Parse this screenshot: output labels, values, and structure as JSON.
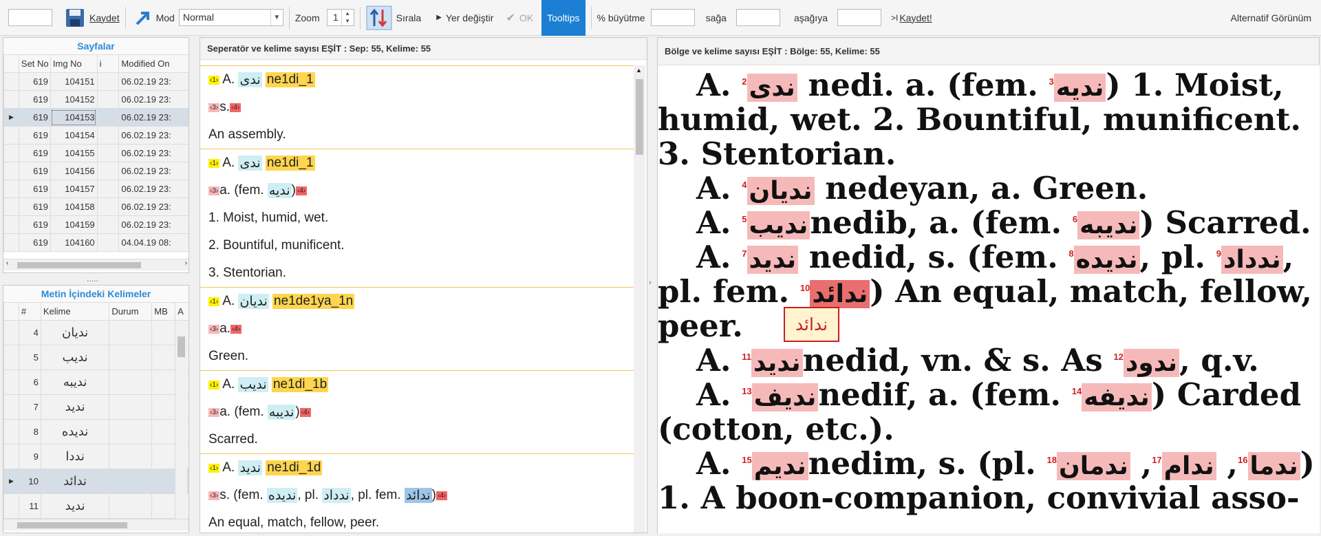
{
  "toolbar": {
    "page_value": "",
    "save_label": "Kaydet",
    "mode_label": "Mod",
    "mode_value": "Normal",
    "zoom_label": "Zoom",
    "zoom_value": "1",
    "sort_label": "Sırala",
    "swap_label": "Yer değiştir",
    "ok_label": "OK",
    "tooltips_label": "Tooltips",
    "enlarge_label": "% büyütme",
    "right_label": "sağa",
    "down_label": "aşağıya",
    "save2_label": "Kaydet!",
    "alt_view_label": "Alternatif Görünüm"
  },
  "pages": {
    "title": "Sayfalar",
    "columns": [
      "Set No",
      "Img No",
      "i",
      "Modified On"
    ],
    "rows": [
      {
        "set": "619",
        "img": "104151",
        "mod": "06.02.19 23:"
      },
      {
        "set": "619",
        "img": "104152",
        "mod": "06.02.19 23:"
      },
      {
        "set": "619",
        "img": "104153",
        "mod": "06.02.19 23:",
        "selected": true
      },
      {
        "set": "619",
        "img": "104154",
        "mod": "06.02.19 23:"
      },
      {
        "set": "619",
        "img": "104155",
        "mod": "06.02.19 23:"
      },
      {
        "set": "619",
        "img": "104156",
        "mod": "06.02.19 23:"
      },
      {
        "set": "619",
        "img": "104157",
        "mod": "06.02.19 23:"
      },
      {
        "set": "619",
        "img": "104158",
        "mod": "06.02.19 23:"
      },
      {
        "set": "619",
        "img": "104159",
        "mod": "06.02.19 23:"
      },
      {
        "set": "619",
        "img": "104160",
        "mod": "04.04.19 08:"
      }
    ]
  },
  "splitter_dots": ".....",
  "words": {
    "title": "Metin İçindeki Kelimeler",
    "columns": [
      "#",
      "Kelime",
      "Durum",
      "MB",
      "A"
    ],
    "rows": [
      {
        "n": "4",
        "w": "نديان"
      },
      {
        "n": "5",
        "w": "نديب"
      },
      {
        "n": "6",
        "w": "نديبه"
      },
      {
        "n": "7",
        "w": "نديد"
      },
      {
        "n": "8",
        "w": "نديده"
      },
      {
        "n": "9",
        "w": "نددا"
      },
      {
        "n": "10",
        "w": "ندائد",
        "selected": true
      },
      {
        "n": "11",
        "w": "نديد"
      }
    ]
  },
  "text_panel": {
    "header": "Seperatör ve kelime sayısı EŞİT  :  Sep: 55, Kelime: 55",
    "m1": "‹1›",
    "m3": "‹3›",
    "m4": "‹4›",
    "e1": {
      "a": "A.",
      "ar": "ندى",
      "tok": "ne1di_1",
      "l2": "s.",
      "l3": "An assembly."
    },
    "e2": {
      "a": "A.",
      "ar": "ندى",
      "tok": "ne1di_1",
      "l2a": "a. (fem.",
      "l2ar": "نديه",
      "l2b": ")",
      "l3": "1. Moist, humid, wet.",
      "l4": "2. Bountiful, munificent.",
      "l5": "3. Stentorian."
    },
    "e3": {
      "a": "A.",
      "ar": "نديان",
      "tok": "ne1de1ya_1n",
      "l2": "a.",
      "l3": "Green."
    },
    "e4": {
      "a": "A.",
      "ar": "نديب",
      "tok": "ne1di_1b",
      "l2a": "a. (fem.",
      "l2ar": "نديبه",
      "l2b": ")",
      "l3": "Scarred."
    },
    "e5": {
      "a": "A.",
      "ar": "نديد",
      "tok": "ne1di_1d",
      "l2a": "s. (fem.",
      "ar1": "نديده",
      "l2b": ", pl.",
      "ar2": "ندداد",
      "l2c": ", pl. fem.",
      "ar3": "ندائد",
      "l2d": ")",
      "l3": "An equal, match, fellow, peer."
    }
  },
  "scan_panel": {
    "header": "Bölge ve kelime sayısı EŞİT  :  Bölge: 55, Kelime: 55",
    "lines": {
      "l1a": "A.",
      "l1ar1": "ندى",
      "l1n1": "2",
      "l1b": "nedi. a. (fem.",
      "l1ar2": "نديه",
      "l1n2": "3",
      "l1c": ") 1. Moist,",
      "l2": "humid, wet. 2. Bountiful, munificent.",
      "l3": "3. Stentorian.",
      "l4a": "A.",
      "l4ar": "نديان",
      "l4n": "4",
      "l4b": "nedeyan, a. Green.",
      "l5a": "A.",
      "l5ar1": "نديب",
      "l5n1": "5",
      "l5b": "nedib, a. (fem.",
      "l5ar2": "نديبه",
      "l5n2": "6",
      "l5c": ") Scarred.",
      "l6a": "A.",
      "l6ar1": "نديد",
      "l6n1": "7",
      "l6b": "nedid, s. (fem.",
      "l6ar2": "نديده",
      "l6n2": "8",
      "l6c": ", pl.",
      "l6ar3": "ندداد",
      "l6n3": "9",
      "l6d": ",",
      "l7a": "pl. fem.",
      "l7ar": "ندائد",
      "l7n": "10",
      "l7b": ") An equal, match, fellow,",
      "l8": "peer.",
      "l9a": "A.",
      "l9ar1": "نديد",
      "l9n1": "11",
      "l9b": "nedid, vn. & s. As",
      "l9ar2": "ندود",
      "l9n2": "12",
      "l9c": ", q.v.",
      "l10a": "A.",
      "l10ar1": "نديف",
      "l10n1": "13",
      "l10b": "nedif, a. (fem.",
      "l10ar2": "نديفه",
      "l10n2": "14",
      "l10c": ") Carded",
      "l11": "(cotton, etc.).",
      "l12a": "A.",
      "l12ar1": "نديم",
      "l12n1": "15",
      "l12b": "nedim, s. (pl.",
      "l12ar2": "ندما",
      "l12n2": "16",
      "l12c": ",",
      "l12ar3": "ندام",
      "l12n3": "17",
      "l12d": ",",
      "l12ar4": "ندمان",
      "l12n4": "18",
      "l12e": ")",
      "l13": "1. A boon-companion, convivial asso-"
    },
    "tooltip": "ندائد"
  }
}
